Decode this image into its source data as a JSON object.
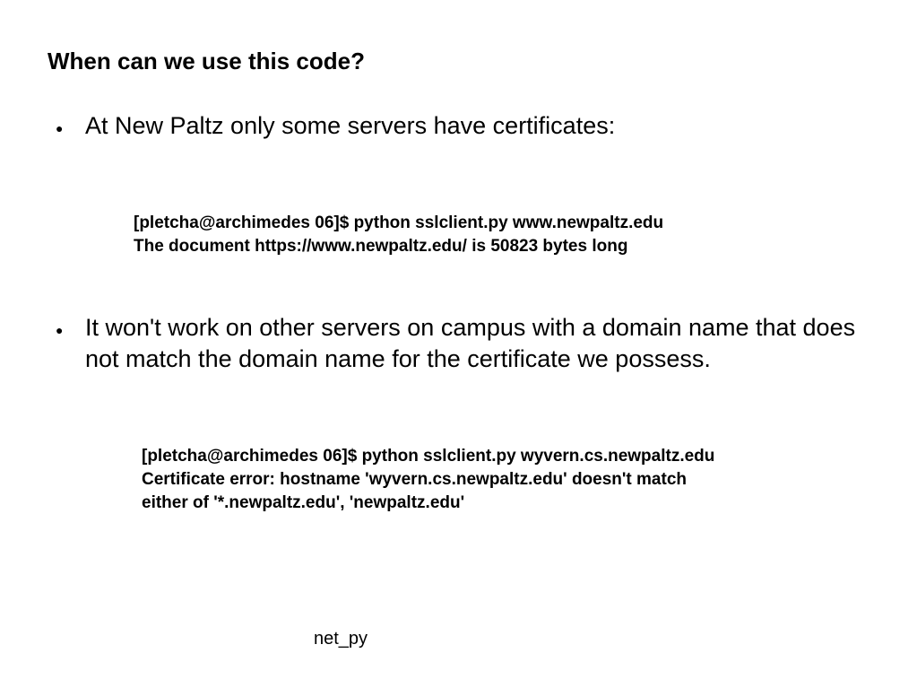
{
  "slide": {
    "title": "When can we use this code?",
    "bullets": [
      {
        "marker": "●",
        "text": "At New Paltz only some servers have certificates:"
      },
      {
        "marker": "●",
        "text": "It won't work on other servers on campus with a domain name that does not match the domain name for the certificate we possess."
      }
    ],
    "code_blocks": [
      {
        "lines": [
          "[pletcha@archimedes 06]$ python sslclient.py www.newpaltz.edu",
          "The document https://www.newpaltz.edu/ is 50823 bytes long"
        ]
      },
      {
        "lines": [
          "[pletcha@archimedes 06]$ python sslclient.py wyvern.cs.newpaltz.edu",
          "Certificate error: hostname 'wyvern.cs.newpaltz.edu' doesn't match",
          "either of '*.newpaltz.edu', 'newpaltz.edu'"
        ]
      }
    ],
    "footer": "net_py"
  }
}
